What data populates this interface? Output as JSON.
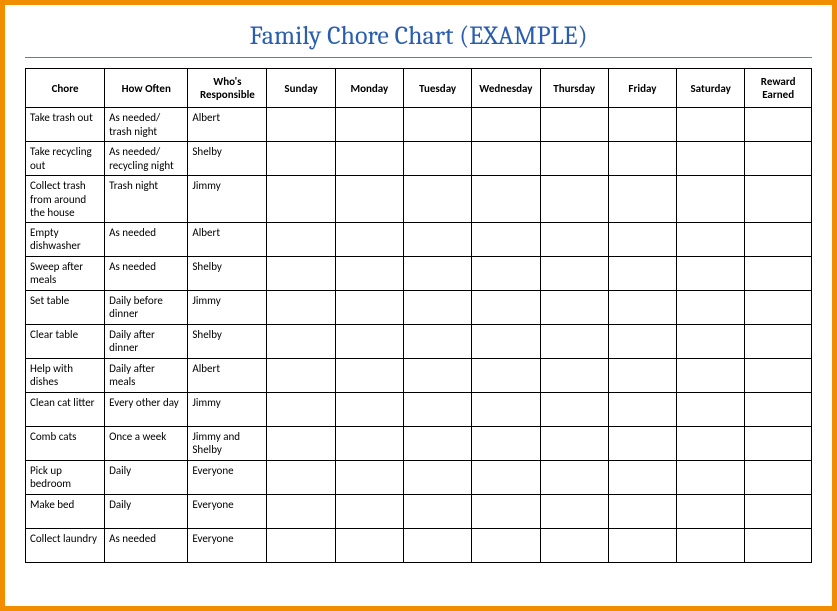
{
  "title": "Family Chore Chart (EXAMPLE)",
  "headers": {
    "chore": "Chore",
    "how_often": "How Often",
    "who": "Who's Responsible",
    "sunday": "Sunday",
    "monday": "Monday",
    "tuesday": "Tuesday",
    "wednesday": "Wednesday",
    "thursday": "Thursday",
    "friday": "Friday",
    "saturday": "Saturday",
    "reward": "Reward Earned"
  },
  "rows": [
    {
      "chore": "Take trash out",
      "how_often": "As needed/ trash night",
      "who": "Albert"
    },
    {
      "chore": "Take recycling out",
      "how_often": "As needed/ recycling night",
      "who": "Shelby"
    },
    {
      "chore": "Collect trash from around the house",
      "how_often": "Trash night",
      "who": "Jimmy"
    },
    {
      "chore": "Empty dishwasher",
      "how_often": "As needed",
      "who": "Albert"
    },
    {
      "chore": "Sweep after meals",
      "how_often": "As needed",
      "who": "Shelby"
    },
    {
      "chore": "Set table",
      "how_often": "Daily before dinner",
      "who": "Jimmy"
    },
    {
      "chore": "Clear table",
      "how_often": "Daily after dinner",
      "who": "Shelby"
    },
    {
      "chore": "Help with dishes",
      "how_often": "Daily after meals",
      "who": "Albert"
    },
    {
      "chore": "Clean cat litter",
      "how_often": "Every other day",
      "who": "Jimmy"
    },
    {
      "chore": "Comb cats",
      "how_often": "Once a week",
      "who": "Jimmy and Shelby"
    },
    {
      "chore": "Pick up bedroom",
      "how_often": "Daily",
      "who": "Everyone"
    },
    {
      "chore": "Make bed",
      "how_often": "Daily",
      "who": "Everyone"
    },
    {
      "chore": "Collect laundry",
      "how_often": "As needed",
      "who": "Everyone"
    }
  ],
  "chart_data": {
    "type": "table",
    "title": "Family Chore Chart (EXAMPLE)",
    "columns": [
      "Chore",
      "How Often",
      "Who's Responsible",
      "Sunday",
      "Monday",
      "Tuesday",
      "Wednesday",
      "Thursday",
      "Friday",
      "Saturday",
      "Reward Earned"
    ],
    "rows": [
      [
        "Take trash out",
        "As needed/ trash night",
        "Albert",
        "",
        "",
        "",
        "",
        "",
        "",
        "",
        ""
      ],
      [
        "Take recycling out",
        "As needed/ recycling night",
        "Shelby",
        "",
        "",
        "",
        "",
        "",
        "",
        "",
        ""
      ],
      [
        "Collect trash from around the house",
        "Trash night",
        "Jimmy",
        "",
        "",
        "",
        "",
        "",
        "",
        "",
        ""
      ],
      [
        "Empty dishwasher",
        "As needed",
        "Albert",
        "",
        "",
        "",
        "",
        "",
        "",
        "",
        ""
      ],
      [
        "Sweep after meals",
        "As needed",
        "Shelby",
        "",
        "",
        "",
        "",
        "",
        "",
        "",
        ""
      ],
      [
        "Set table",
        "Daily before dinner",
        "Jimmy",
        "",
        "",
        "",
        "",
        "",
        "",
        "",
        ""
      ],
      [
        "Clear table",
        "Daily after dinner",
        "Shelby",
        "",
        "",
        "",
        "",
        "",
        "",
        "",
        ""
      ],
      [
        "Help with dishes",
        "Daily after meals",
        "Albert",
        "",
        "",
        "",
        "",
        "",
        "",
        "",
        ""
      ],
      [
        "Clean cat litter",
        "Every other day",
        "Jimmy",
        "",
        "",
        "",
        "",
        "",
        "",
        "",
        ""
      ],
      [
        "Comb cats",
        "Once a week",
        "Jimmy and Shelby",
        "",
        "",
        "",
        "",
        "",
        "",
        "",
        ""
      ],
      [
        "Pick up bedroom",
        "Daily",
        "Everyone",
        "",
        "",
        "",
        "",
        "",
        "",
        "",
        ""
      ],
      [
        "Make bed",
        "Daily",
        "Everyone",
        "",
        "",
        "",
        "",
        "",
        "",
        "",
        ""
      ],
      [
        "Collect laundry",
        "As needed",
        "Everyone",
        "",
        "",
        "",
        "",
        "",
        "",
        "",
        ""
      ]
    ]
  }
}
